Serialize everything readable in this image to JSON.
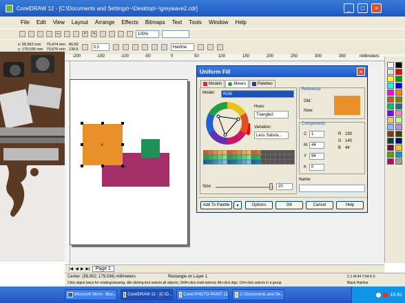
{
  "window": {
    "title": "CorelDRAW 12 - [C:\\Documents and Settings\\~\\Desktop\\~\\greywave2.cdr]"
  },
  "menu": [
    "File",
    "Edit",
    "View",
    "Layout",
    "Arrange",
    "Effects",
    "Bitmaps",
    "Text",
    "Tools",
    "Window",
    "Help"
  ],
  "toolbar": {
    "zoom": "100%",
    "snap": ""
  },
  "property_bar": {
    "x": "59,952 mm",
    "y": "179,036 mm",
    "width": "70,474 mm",
    "height": "70,679 mm",
    "scale_x": "86,50",
    "scale_y": "139,5",
    "angle": "0,0",
    "outline": "Hairline"
  },
  "ruler": {
    "unit": "millimeters",
    "ticks": [
      "-200",
      "-150",
      "-100",
      "-50",
      "0",
      "50",
      "100",
      "150",
      "200",
      "250",
      "300",
      "350"
    ]
  },
  "dialog": {
    "title": "Uniform Fill",
    "tabs": [
      "Models",
      "Mixers",
      "Palettes"
    ],
    "active_tab": "Mixers",
    "model_label": "Model:",
    "model_value": "RGB",
    "hues_label": "Hues:",
    "hues_value": "Triangle2",
    "variation_label": "Variation:",
    "variation_value": "Less Satura...",
    "size_label": "Size:",
    "size_value": "20",
    "reference_label": "Reference",
    "old_label": "Old:",
    "new_label": "New:",
    "components_label": "Components",
    "components": [
      {
        "key": "C",
        "value": "1"
      },
      {
        "key": "M",
        "value": "44"
      },
      {
        "key": "Y",
        "value": "94"
      },
      {
        "key": "K",
        "value": "0"
      }
    ],
    "rgb": [
      {
        "key": "R",
        "value": "230"
      },
      {
        "key": "G",
        "value": "140"
      },
      {
        "key": "B",
        "value": "44"
      }
    ],
    "name_label": "Name:",
    "name_value": "",
    "buttons": {
      "add_palette": "Add To Palette",
      "options": "Options",
      "ok": "OK",
      "cancel": "Cancel",
      "help": "Help"
    },
    "old_color": "#ffffff",
    "new_color": "#e8912b"
  },
  "page_tab": "Page 1",
  "status": {
    "center": "Center: (59,952; 179,036) millimeters",
    "object": "Rectangle on Layer 1",
    "hint": "Click object twice for rotating/skewing; dbl-clicking tool selects all objects; Shift+click multi-selects; Alt+click digs; Ctrl+click selects in a group",
    "fill_info": "C:1 M:44 Y:94 K:0",
    "outline_info": "Black  Hairline"
  },
  "taskbar": {
    "tasks": [
      "Microsoft Word - Boo...",
      "CorelDRAW 12 - [C:\\D...",
      "Corel PHOTO-PAINT 12",
      "C:\\Documents and Se..."
    ],
    "clock": "10:41"
  },
  "colors": {
    "orange": "#e8912b",
    "green": "#1f8f55",
    "magenta": "#a62f6a"
  }
}
